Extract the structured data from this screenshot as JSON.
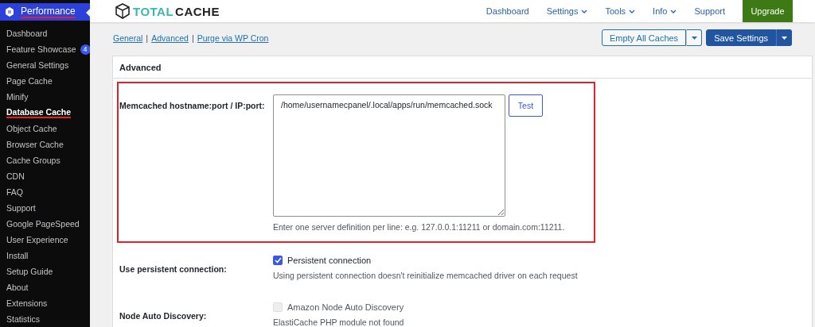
{
  "sidebar": {
    "menu": {
      "label": "Performance",
      "selected": true
    },
    "items": [
      {
        "label": "Dashboard",
        "selected": false
      },
      {
        "label": "Feature Showcase",
        "selected": false,
        "badge": "4"
      },
      {
        "label": "General Settings",
        "selected": false
      },
      {
        "label": "Page Cache",
        "selected": false
      },
      {
        "label": "Minify",
        "selected": false
      },
      {
        "label": "Database Cache",
        "selected": true
      },
      {
        "label": "Object Cache",
        "selected": false
      },
      {
        "label": "Browser Cache",
        "selected": false
      },
      {
        "label": "Cache Groups",
        "selected": false
      },
      {
        "label": "CDN",
        "selected": false
      },
      {
        "label": "FAQ",
        "selected": false
      },
      {
        "label": "Support",
        "selected": false
      },
      {
        "label": "Google PageSpeed",
        "selected": false
      },
      {
        "label": "User Experience",
        "selected": false
      },
      {
        "label": "Install",
        "selected": false
      },
      {
        "label": "Setup Guide",
        "selected": false
      },
      {
        "label": "About",
        "selected": false
      },
      {
        "label": "Extensions",
        "selected": false
      },
      {
        "label": "Statistics",
        "selected": false
      }
    ]
  },
  "header": {
    "logo": {
      "word_1": "TOTAL",
      "word_2": "CACHE"
    },
    "nav": [
      {
        "label": "Dashboard",
        "dropdown": false
      },
      {
        "label": "Settings",
        "dropdown": true
      },
      {
        "label": "Tools",
        "dropdown": true
      },
      {
        "label": "Info",
        "dropdown": true
      },
      {
        "label": "Support",
        "dropdown": false
      }
    ],
    "upgrade": "Upgrade"
  },
  "links": {
    "separator": "|",
    "items": [
      "General",
      "Advanced",
      "Purge via WP Cron"
    ]
  },
  "actions": [
    {
      "label": "Empty All Caches",
      "primary": false
    },
    {
      "label": "Save Settings",
      "primary": true
    }
  ],
  "panel": {
    "title": "Advanced",
    "rows": [
      {
        "kind": "textarea",
        "label": "Memcached hostname:port / IP:port:",
        "highlighted": true,
        "value": "/home/usernamecpanel/.local/apps/run/memcached.sock",
        "button": "Test",
        "hint": "Enter one server definition per line: e.g. 127.0.0.1:11211 or domain.com:11211."
      },
      {
        "kind": "checkbox",
        "label": "Use persistent connection:",
        "highlighted": false,
        "option": "Persistent connection",
        "checked": true,
        "disabled": false,
        "hint": "Using persistent connection doesn't reinitialize memcached driver on each request"
      },
      {
        "kind": "checkbox",
        "label": "Node Auto Discovery:",
        "highlighted": false,
        "option": "Amazon Node Auto Discovery",
        "checked": false,
        "disabled": true,
        "hint": "ElastiCache PHP module not found"
      }
    ]
  }
}
